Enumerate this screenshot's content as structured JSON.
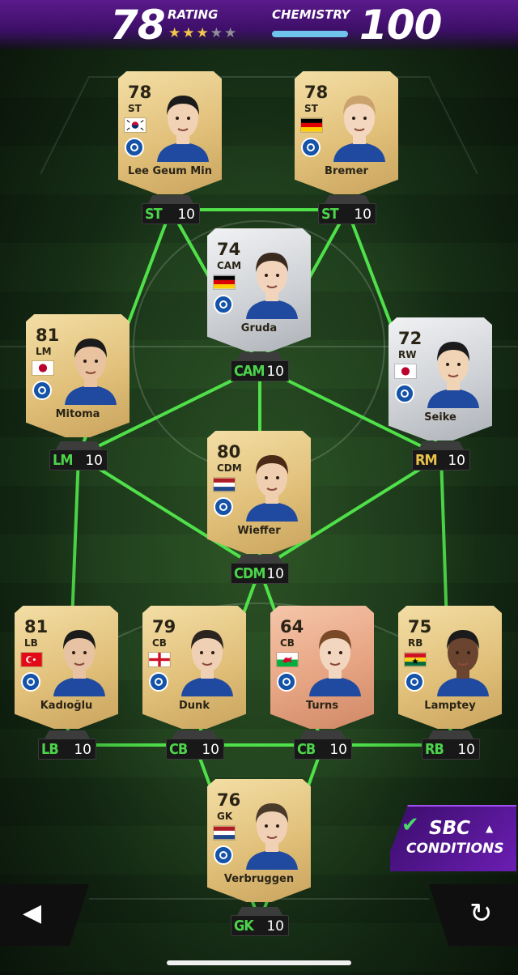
{
  "header": {
    "rating_label": "RATING",
    "rating_value": "78",
    "stars_filled": 3,
    "stars_total": 5,
    "chemistry_label": "CHEMISTRY",
    "chemistry_value": "100"
  },
  "players": [
    {
      "name": "Lee Geum Min",
      "rating": "78",
      "position": "ST",
      "flag": "south-korea",
      "card": "gold",
      "slot": "ST",
      "chem": "10"
    },
    {
      "name": "Bremer",
      "rating": "78",
      "position": "ST",
      "flag": "germany",
      "card": "gold",
      "slot": "ST",
      "chem": "10"
    },
    {
      "name": "Gruda",
      "rating": "74",
      "position": "CAM",
      "flag": "germany",
      "card": "silver",
      "slot": "CAM",
      "chem": "10"
    },
    {
      "name": "Mitoma",
      "rating": "81",
      "position": "LM",
      "flag": "japan",
      "card": "gold",
      "slot": "LM",
      "chem": "10"
    },
    {
      "name": "Seike",
      "rating": "72",
      "position": "RW",
      "flag": "japan",
      "card": "silver",
      "slot": "RM",
      "chem": "10"
    },
    {
      "name": "Wieffer",
      "rating": "80",
      "position": "CDM",
      "flag": "netherlands",
      "card": "gold",
      "slot": "CDM",
      "chem": "10"
    },
    {
      "name": "Kadıoğlu",
      "rating": "81",
      "position": "LB",
      "flag": "turkey",
      "card": "gold",
      "slot": "LB",
      "chem": "10"
    },
    {
      "name": "Dunk",
      "rating": "79",
      "position": "CB",
      "flag": "england",
      "card": "gold",
      "slot": "CB",
      "chem": "10"
    },
    {
      "name": "Turns",
      "rating": "64",
      "position": "CB",
      "flag": "wales",
      "card": "bronze",
      "slot": "CB",
      "chem": "10"
    },
    {
      "name": "Lamptey",
      "rating": "75",
      "position": "RB",
      "flag": "ghana",
      "card": "gold",
      "slot": "RB",
      "chem": "10"
    },
    {
      "name": "Verbruggen",
      "rating": "76",
      "position": "GK",
      "flag": "netherlands",
      "card": "gold",
      "slot": "GK",
      "chem": "10"
    }
  ],
  "sbc_button": {
    "title": "SBC",
    "subtitle": "CONDITIONS"
  },
  "icons": {
    "back": "back-arrow-icon",
    "reset": "reset-icon",
    "check": "check-icon",
    "caret": "caret-up-icon"
  },
  "colors": {
    "link": "#4fe04a",
    "accent": "#6b1eb3",
    "chem_bar": "#6ec4ea",
    "star": "#f1c84a"
  }
}
